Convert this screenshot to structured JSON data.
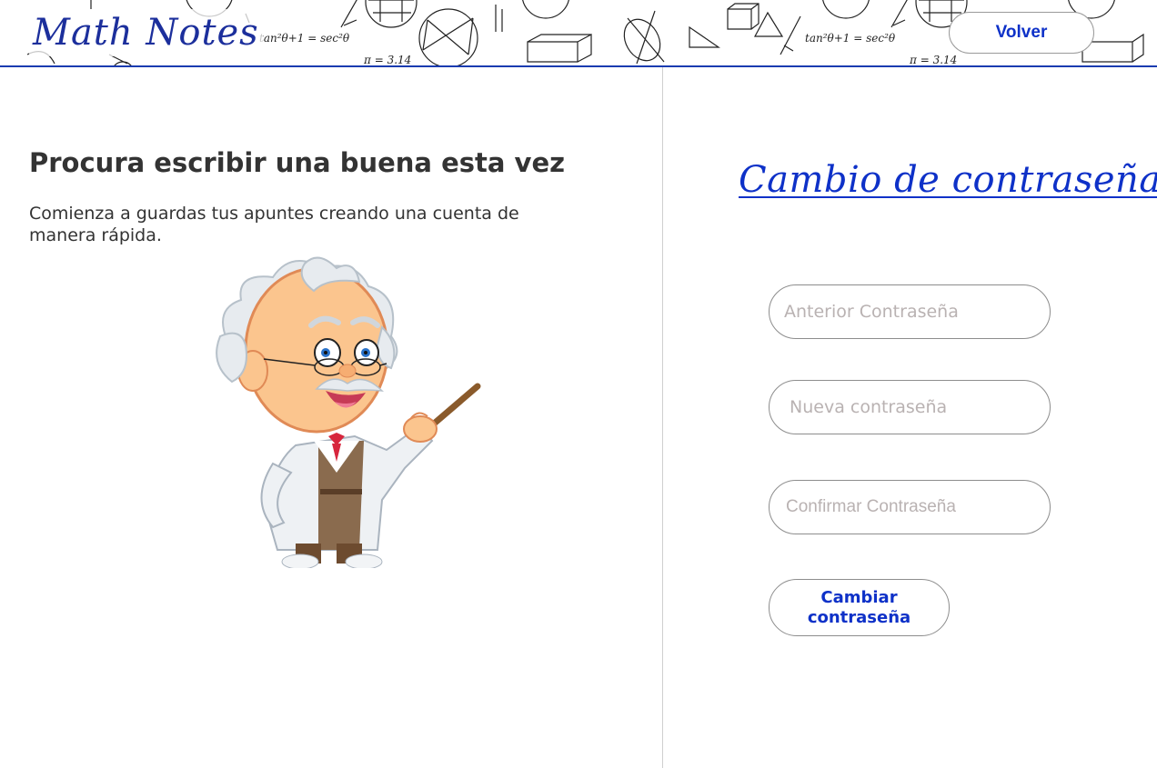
{
  "header": {
    "logo": "Math Notes",
    "back_button": "Volver",
    "doodle_formulas": [
      "tan²θ+1 = sec²θ",
      "π = 3.14"
    ]
  },
  "left": {
    "heading": "Procura escribir una buena esta vez",
    "description": "Comienza a guardas tus apuntes creando una cuenta de manera rápida.",
    "illustration": "professor-illustration"
  },
  "right": {
    "title": "Cambio de contraseña",
    "fields": [
      {
        "placeholder": "Anterior Contraseña",
        "value": ""
      },
      {
        "placeholder": "Nueva contraseña",
        "value": ""
      },
      {
        "placeholder": "Confirmar Contraseña",
        "value": ""
      }
    ],
    "submit_label": "Cambiar contraseña"
  },
  "colors": {
    "accent": "#0e31c8",
    "logo": "#1c2f9c",
    "header_border": "#1a3bb0",
    "text": "#333333",
    "placeholder": "#b9b2b2"
  }
}
